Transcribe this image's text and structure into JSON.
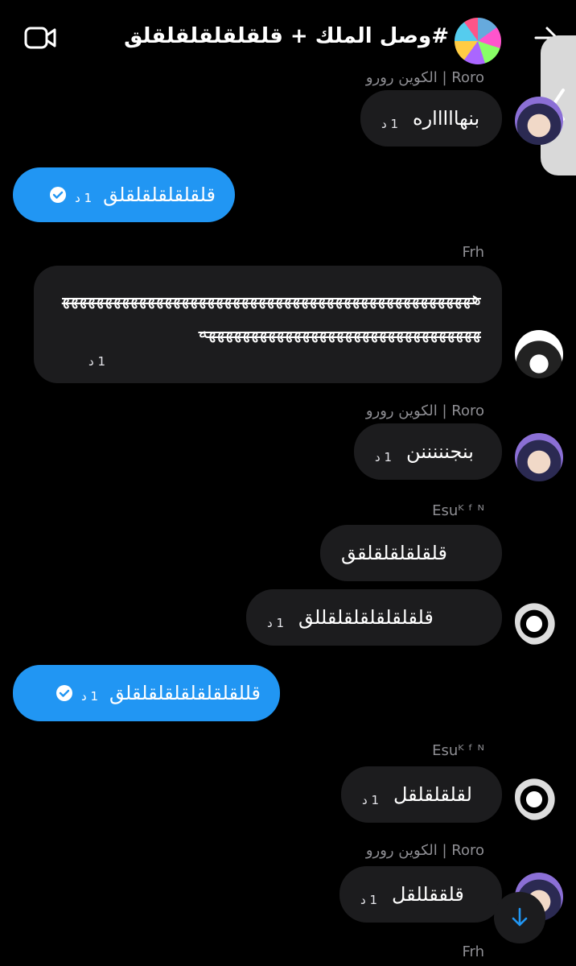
{
  "header": {
    "title": "#وصل الملك + قلقلقلقلقلقلق",
    "video_icon": "video-camera-icon",
    "back_icon": "arrow-right-icon"
  },
  "colors": {
    "accent": "#2196f3",
    "bubble": "#1c1c1e",
    "meta": "#8e8e93"
  },
  "messages": [
    {
      "sender": "الكوين رورو | Roro",
      "text": "بنهاااااره",
      "time": "1 د"
    },
    {
      "text": "قلقلقلقلقلقلق",
      "time": "1 د"
    },
    {
      "sender": "Frh",
      "text": "هههههههههههههههههههههههههههههههههههههههههههههههههههههههههههههههههههههههههههههههههه",
      "time": "1 د"
    },
    {
      "sender": "الكوين رورو | Roro",
      "text": "بنجنننننن",
      "time": "1 د"
    },
    {
      "sender": "Esuᴷ ᶠ ᴺ",
      "text": "قلقلقلقلقلقق"
    },
    {
      "text": "قلقلقلقلقلقلقللق",
      "time": "1 د"
    },
    {
      "text": "قللقلقلقلقلقلقلقلق",
      "time": "1 د"
    },
    {
      "sender": "Esuᴷ ᶠ ᴺ",
      "text": "لقلقلقلقل",
      "time": "1 د"
    },
    {
      "sender": "الكوين رورو | Roro",
      "text": "قلققللقل",
      "time": "1 د"
    },
    {
      "sender": "Frh"
    }
  ]
}
